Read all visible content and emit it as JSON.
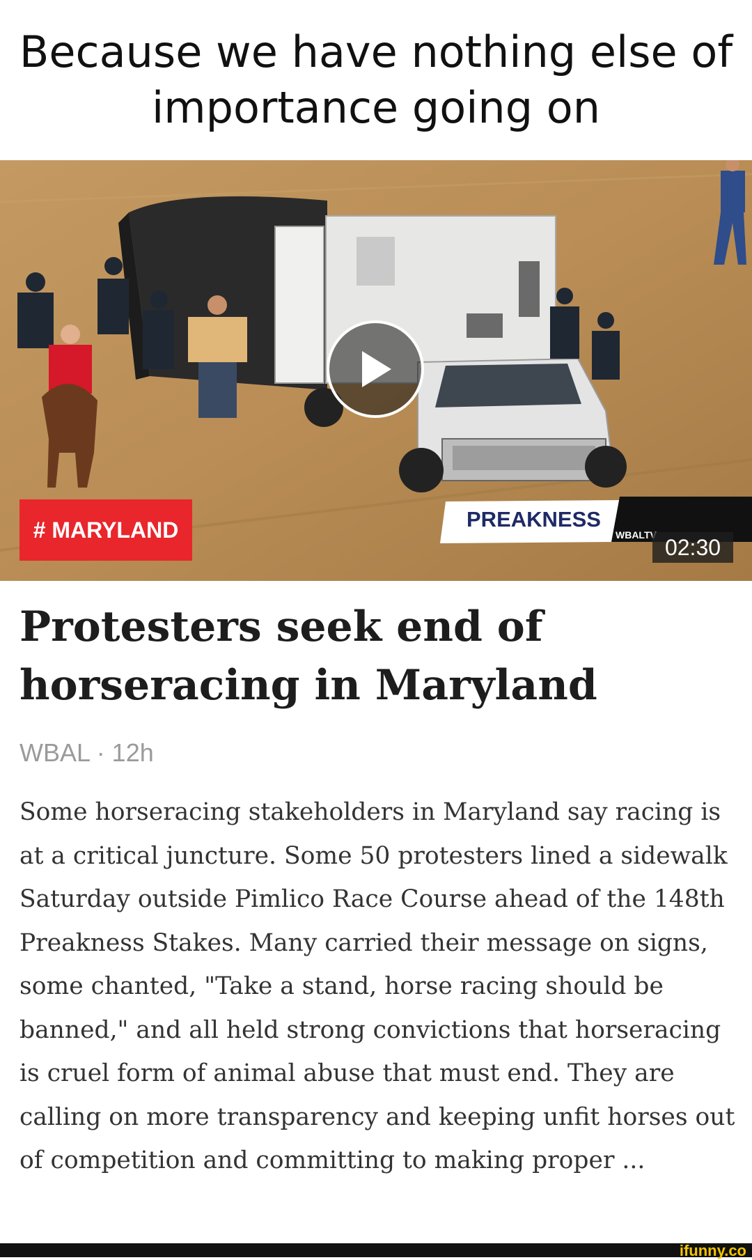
{
  "caption": "Because we have nothing else of importance going on",
  "card": {
    "tag": "# MARYLAND",
    "duration": "02:30",
    "broadcast_bug": "PREAKNESS",
    "station_label": "WBALTV",
    "headline": "Protesters seek end of horseracing in Maryland",
    "source": "WBAL · 12h",
    "summary": "Some horseracing stakeholders in Maryland say racing is at a critical juncture. Some 50 protesters lined a sidewalk Saturday outside Pimlico Race Course ahead of the 148th Preakness Stakes. Many carried their message on signs, some chanted, \"Take a stand, horse racing should be banned,\" and all held strong convictions that horseracing is cruel form of animal abuse that must end. They are calling on more transparency and keeping unfit horses out of competition and committing to making proper ..."
  },
  "watermark": "ifunny.co",
  "colors": {
    "tag_background": "#e8262b",
    "headline": "#1d1d1d",
    "meta": "#9a9a9a",
    "dirt_track": "#b98d55"
  },
  "icons": {
    "play": "play-icon"
  }
}
